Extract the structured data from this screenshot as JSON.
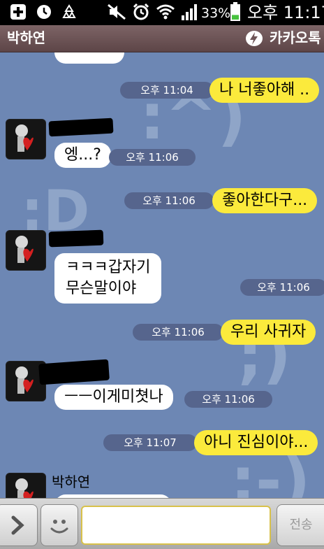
{
  "status_bar": {
    "battery_percent": "33%",
    "clock": "오후 11:17",
    "battery_level": 0.33,
    "icons": [
      "add-icon",
      "clock-icon",
      "recycle-icon",
      "mute-icon",
      "alarm-icon",
      "wifi-icon",
      "signal-icon",
      "battery-icon"
    ]
  },
  "header": {
    "title": "박하연",
    "app_name": "카카오톡",
    "bar_color": "#6e5557"
  },
  "colors": {
    "chat_background": "#6d87b4",
    "my_bubble": "#fbea3c",
    "their_bubble": "#ffffff",
    "time_pill": "#56658d"
  },
  "messages": [
    {
      "from": "them",
      "text": "",
      "time": ""
    },
    {
      "from": "me",
      "text": "나 너좋아해 ..",
      "time": "오후 11:04"
    },
    {
      "from": "them",
      "text": "엥...?",
      "time": "오후 11:06"
    },
    {
      "from": "me",
      "text": "좋아한다구...",
      "time": "오후 11:06"
    },
    {
      "from": "them",
      "lines": [
        "ㅋㅋㅋ갑자기",
        "무슨말이야"
      ],
      "time": "오후 11:06"
    },
    {
      "from": "me",
      "text": "우리 사귀자",
      "time": "오후 11:06"
    },
    {
      "from": "them",
      "text": "ㅡㅡ이게미쳣나",
      "time": "오후 11:06"
    },
    {
      "from": "me",
      "text": "아니 진심이야...",
      "time": "오후 11:07"
    },
    {
      "from": "them",
      "sender": "박하연",
      "text": ""
    }
  ],
  "input_bar": {
    "message_value": "",
    "send_label": "전송",
    "expand_icon": "chevron-right-icon",
    "emoticon_icon": "smiley-icon"
  }
}
